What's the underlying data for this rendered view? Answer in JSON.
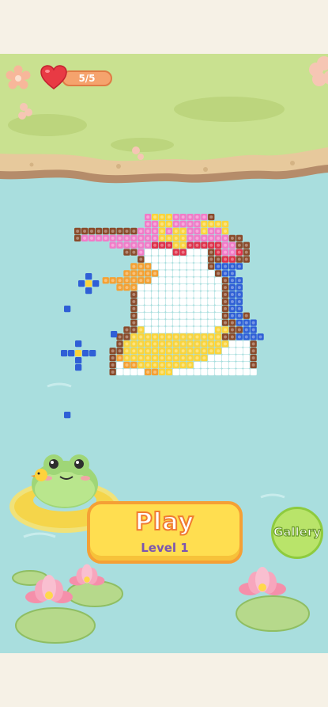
{
  "hud": {
    "lives_text": "5/5"
  },
  "play": {
    "label": "Play",
    "level": "Level 1"
  },
  "gallery": {
    "label": "Gallery"
  },
  "colors": {
    "water": "#a9dede",
    "grass": "#c9e190",
    "pink": "#f27bc8",
    "yellow": "#fbd43b",
    "orange": "#f5a032",
    "white": "#ffffff",
    "brown": "#8a4a2a",
    "blue": "#2f5fd6",
    "red": "#e0314a"
  },
  "icons": [
    "settings-gear-icon",
    "heart-icon",
    "frog-icon",
    "lotus-flower-icon",
    "lily-pad-icon"
  ],
  "puzzle": {
    "rows": [
      "..........PYYYPPPPPN........",
      "..........PPYYPPPPYYYY......",
      "NNNNNNNNNPPPYPYYPPYPPY......",
      "NPPPPPPPPPPPYYYYPPPPPPNN....",
      ".....PPPPPPRRRYYRRRRRPPNN...",
      ".......NNPWWWWRRWWWNRPPRN...",
      ".........NWWWWWWWWWNNRRNN...",
      "........OOOWWWWWWWWNBBBB....",
      ".......OOOOOWWWWWWWWNBB.....",
      "....OOOOOOOWWWWWWWWWWNBB....",
      "......OOOWWWWWWWWWWWWNBB....",
      "........NWWWWWWWWWWWWNBB....",
      "........NWWWWWWWWWWWWNBB....",
      "........NWWWWWWWWWWWWNBB....",
      "........NWWWWWWWWWWWWNBBN...",
      "........NWWWWWWWWWWWWNNBBB..",
      ".......NNYWWWWWWWWWWYYNNBB..",
      "......NNYYYYYYYYYYYYYNNBBBB.",
      "......NYYYYYYYYYYYYYYYWWWN..",
      ".....NNYYYYYYYYYYYYYYWWWWN..",
      ".....NOYYYYYYYYYYYYWWWWWWN..",
      ".....NWOOYYYYYYYYWWWWWWWWN..",
      ".....NWWWWOOYYWWWWWWWWWWWW.."
    ]
  }
}
